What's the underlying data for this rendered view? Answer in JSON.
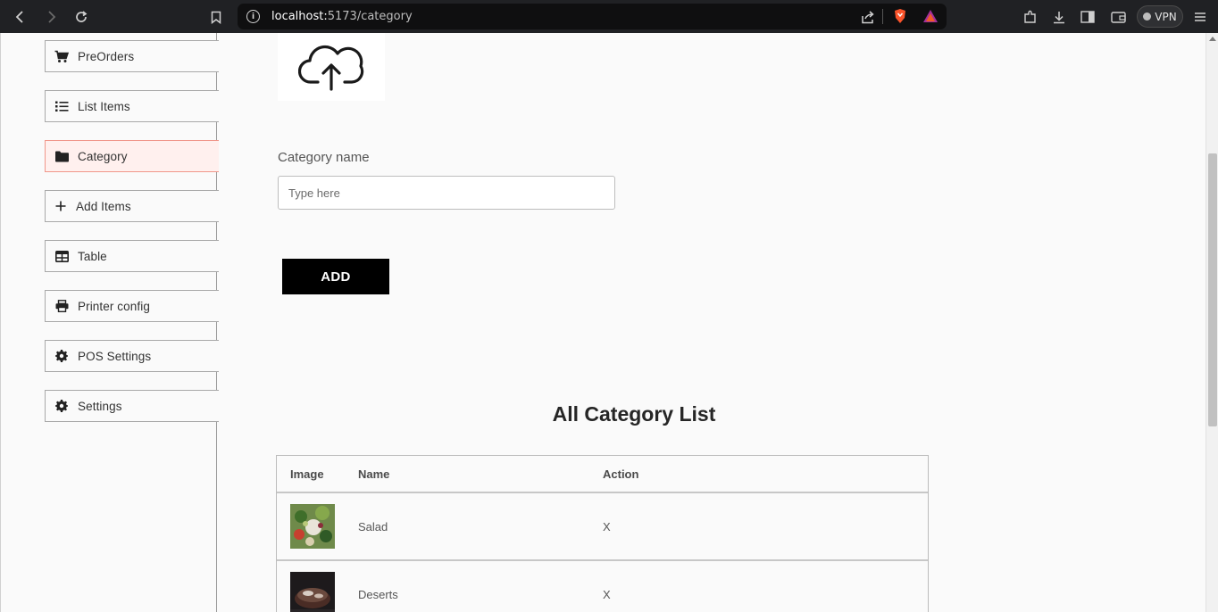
{
  "browser": {
    "url_host": "localhost:",
    "url_port_path": "5173/category",
    "vpn_label": "VPN"
  },
  "sidebar": {
    "items": [
      {
        "label": "PreOrders",
        "icon": "cart-icon"
      },
      {
        "label": "List Items",
        "icon": "list-icon"
      },
      {
        "label": "Category",
        "icon": "folder-icon",
        "active": true
      },
      {
        "label": "Add Items",
        "icon": "plus-icon"
      },
      {
        "label": "Table",
        "icon": "table-icon"
      },
      {
        "label": "Printer config",
        "icon": "printer-icon"
      },
      {
        "label": "POS Settings",
        "icon": "gear-icon"
      },
      {
        "label": "Settings",
        "icon": "gear-icon"
      }
    ]
  },
  "form": {
    "upload_icon": "cloud-upload-icon",
    "category_label": "Category name",
    "category_placeholder": "Type here",
    "category_value": "",
    "add_button": "ADD"
  },
  "list": {
    "title": "All Category List",
    "columns": [
      "Image",
      "Name",
      "Action"
    ],
    "rows": [
      {
        "name": "Salad",
        "action": "X"
      },
      {
        "name": "Deserts",
        "action": "X"
      }
    ]
  },
  "colors": {
    "active_bg": "#fff0ee",
    "active_border": "#f0968a",
    "button_bg": "#000000",
    "chrome_bg": "#202124"
  }
}
